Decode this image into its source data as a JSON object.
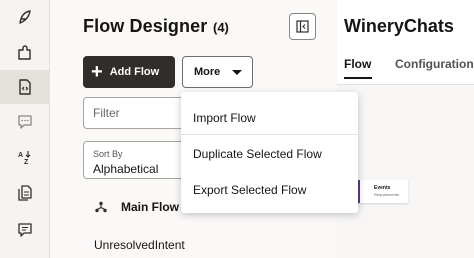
{
  "sidebar": {
    "items": [
      {
        "icon": "feather-icon"
      },
      {
        "icon": "puzzle-icon"
      },
      {
        "icon": "flow-document-icon",
        "active": true
      },
      {
        "icon": "chat-bubble-icon"
      },
      {
        "icon": "sort-az-icon"
      },
      {
        "icon": "documents-icon"
      },
      {
        "icon": "comment-icon"
      }
    ]
  },
  "panel": {
    "title": "Flow Designer",
    "count": "(4)",
    "add_button": {
      "icon": "plus-icon",
      "label": "Add Flow"
    },
    "more_button": {
      "label": "More",
      "icon": "caret-down-icon"
    },
    "filter": {
      "placeholder": "Filter"
    },
    "sort": {
      "caption": "Sort By",
      "value": "Alphabetical"
    },
    "main_flow": {
      "icon": "flow-tree-icon",
      "label": "Main Flow"
    },
    "flows": [
      "UnresolvedIntent"
    ]
  },
  "more_menu": {
    "items": [
      "Import Flow",
      "Duplicate Selected Flow",
      "Export Selected Flow"
    ]
  },
  "editor": {
    "bot_name": "WineryChats",
    "tabs": [
      {
        "label": "Flow",
        "active": true
      },
      {
        "label": "Configuration"
      }
    ],
    "node": {
      "title": "Events",
      "subtitle": "Requirements",
      "accent": "#5b3c82"
    }
  },
  "colors": {
    "dark_button": "#312d2a",
    "rail_bg": "#f5f4f2",
    "rail_active": "#e4e1dd"
  }
}
